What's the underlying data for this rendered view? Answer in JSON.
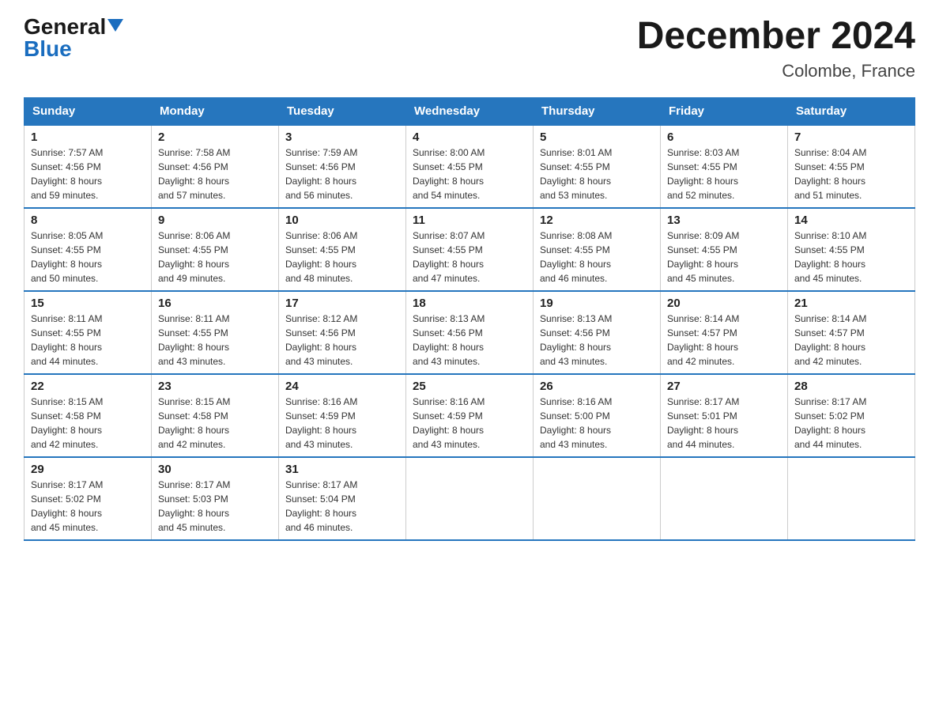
{
  "header": {
    "logo_general": "General",
    "logo_blue": "Blue",
    "month_year": "December 2024",
    "location": "Colombe, France"
  },
  "days_of_week": [
    "Sunday",
    "Monday",
    "Tuesday",
    "Wednesday",
    "Thursday",
    "Friday",
    "Saturday"
  ],
  "weeks": [
    [
      {
        "day": "1",
        "info": "Sunrise: 7:57 AM\nSunset: 4:56 PM\nDaylight: 8 hours\nand 59 minutes."
      },
      {
        "day": "2",
        "info": "Sunrise: 7:58 AM\nSunset: 4:56 PM\nDaylight: 8 hours\nand 57 minutes."
      },
      {
        "day": "3",
        "info": "Sunrise: 7:59 AM\nSunset: 4:56 PM\nDaylight: 8 hours\nand 56 minutes."
      },
      {
        "day": "4",
        "info": "Sunrise: 8:00 AM\nSunset: 4:55 PM\nDaylight: 8 hours\nand 54 minutes."
      },
      {
        "day": "5",
        "info": "Sunrise: 8:01 AM\nSunset: 4:55 PM\nDaylight: 8 hours\nand 53 minutes."
      },
      {
        "day": "6",
        "info": "Sunrise: 8:03 AM\nSunset: 4:55 PM\nDaylight: 8 hours\nand 52 minutes."
      },
      {
        "day": "7",
        "info": "Sunrise: 8:04 AM\nSunset: 4:55 PM\nDaylight: 8 hours\nand 51 minutes."
      }
    ],
    [
      {
        "day": "8",
        "info": "Sunrise: 8:05 AM\nSunset: 4:55 PM\nDaylight: 8 hours\nand 50 minutes."
      },
      {
        "day": "9",
        "info": "Sunrise: 8:06 AM\nSunset: 4:55 PM\nDaylight: 8 hours\nand 49 minutes."
      },
      {
        "day": "10",
        "info": "Sunrise: 8:06 AM\nSunset: 4:55 PM\nDaylight: 8 hours\nand 48 minutes."
      },
      {
        "day": "11",
        "info": "Sunrise: 8:07 AM\nSunset: 4:55 PM\nDaylight: 8 hours\nand 47 minutes."
      },
      {
        "day": "12",
        "info": "Sunrise: 8:08 AM\nSunset: 4:55 PM\nDaylight: 8 hours\nand 46 minutes."
      },
      {
        "day": "13",
        "info": "Sunrise: 8:09 AM\nSunset: 4:55 PM\nDaylight: 8 hours\nand 45 minutes."
      },
      {
        "day": "14",
        "info": "Sunrise: 8:10 AM\nSunset: 4:55 PM\nDaylight: 8 hours\nand 45 minutes."
      }
    ],
    [
      {
        "day": "15",
        "info": "Sunrise: 8:11 AM\nSunset: 4:55 PM\nDaylight: 8 hours\nand 44 minutes."
      },
      {
        "day": "16",
        "info": "Sunrise: 8:11 AM\nSunset: 4:55 PM\nDaylight: 8 hours\nand 43 minutes."
      },
      {
        "day": "17",
        "info": "Sunrise: 8:12 AM\nSunset: 4:56 PM\nDaylight: 8 hours\nand 43 minutes."
      },
      {
        "day": "18",
        "info": "Sunrise: 8:13 AM\nSunset: 4:56 PM\nDaylight: 8 hours\nand 43 minutes."
      },
      {
        "day": "19",
        "info": "Sunrise: 8:13 AM\nSunset: 4:56 PM\nDaylight: 8 hours\nand 43 minutes."
      },
      {
        "day": "20",
        "info": "Sunrise: 8:14 AM\nSunset: 4:57 PM\nDaylight: 8 hours\nand 42 minutes."
      },
      {
        "day": "21",
        "info": "Sunrise: 8:14 AM\nSunset: 4:57 PM\nDaylight: 8 hours\nand 42 minutes."
      }
    ],
    [
      {
        "day": "22",
        "info": "Sunrise: 8:15 AM\nSunset: 4:58 PM\nDaylight: 8 hours\nand 42 minutes."
      },
      {
        "day": "23",
        "info": "Sunrise: 8:15 AM\nSunset: 4:58 PM\nDaylight: 8 hours\nand 42 minutes."
      },
      {
        "day": "24",
        "info": "Sunrise: 8:16 AM\nSunset: 4:59 PM\nDaylight: 8 hours\nand 43 minutes."
      },
      {
        "day": "25",
        "info": "Sunrise: 8:16 AM\nSunset: 4:59 PM\nDaylight: 8 hours\nand 43 minutes."
      },
      {
        "day": "26",
        "info": "Sunrise: 8:16 AM\nSunset: 5:00 PM\nDaylight: 8 hours\nand 43 minutes."
      },
      {
        "day": "27",
        "info": "Sunrise: 8:17 AM\nSunset: 5:01 PM\nDaylight: 8 hours\nand 44 minutes."
      },
      {
        "day": "28",
        "info": "Sunrise: 8:17 AM\nSunset: 5:02 PM\nDaylight: 8 hours\nand 44 minutes."
      }
    ],
    [
      {
        "day": "29",
        "info": "Sunrise: 8:17 AM\nSunset: 5:02 PM\nDaylight: 8 hours\nand 45 minutes."
      },
      {
        "day": "30",
        "info": "Sunrise: 8:17 AM\nSunset: 5:03 PM\nDaylight: 8 hours\nand 45 minutes."
      },
      {
        "day": "31",
        "info": "Sunrise: 8:17 AM\nSunset: 5:04 PM\nDaylight: 8 hours\nand 46 minutes."
      },
      null,
      null,
      null,
      null
    ]
  ]
}
